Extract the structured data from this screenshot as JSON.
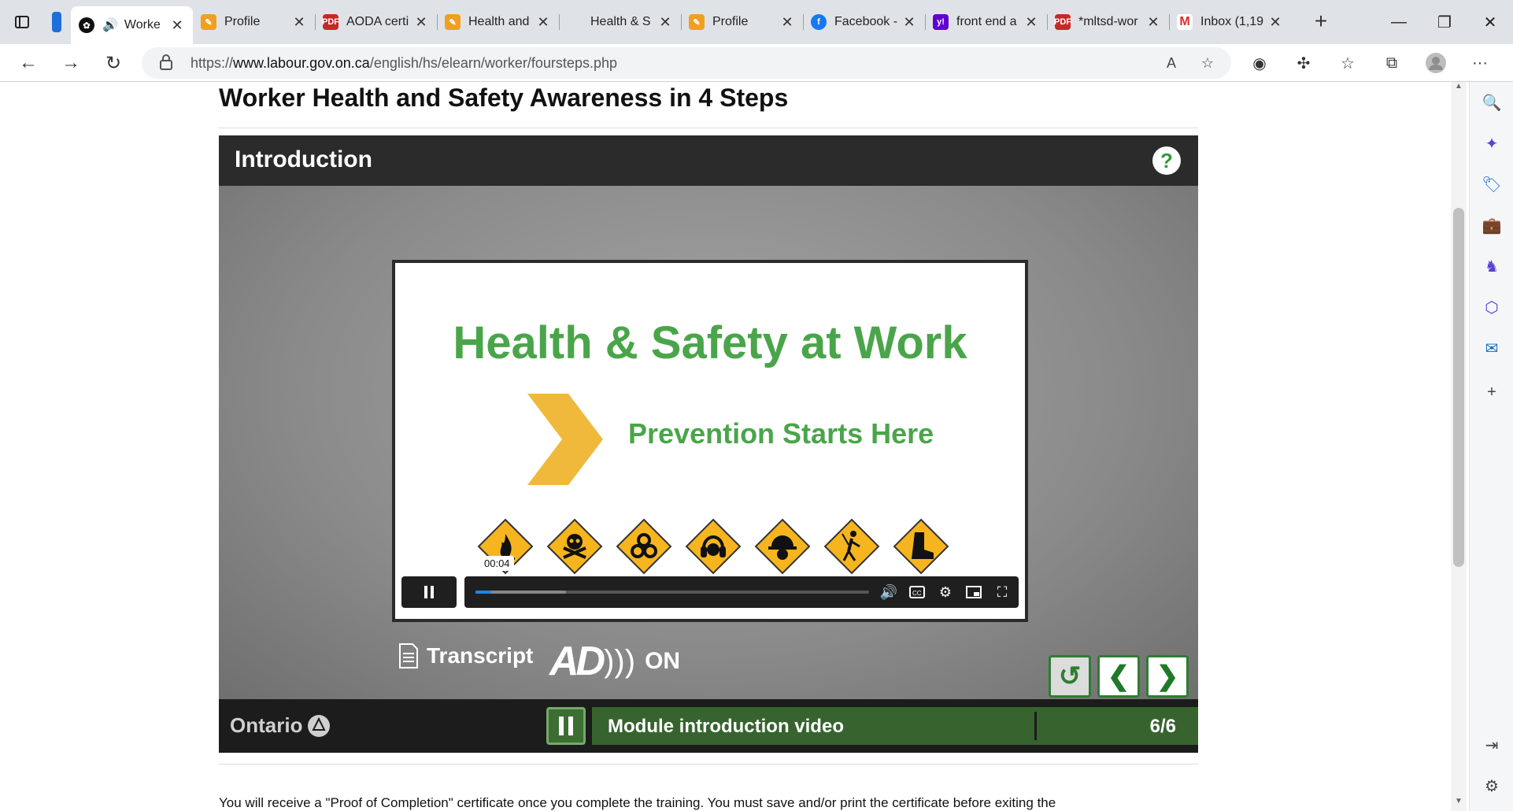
{
  "browser": {
    "tabs": [
      {
        "title": "Worke",
        "active": true,
        "favicon": "ontario-trillium-icon",
        "audio": true
      },
      {
        "title": "Profile",
        "favicon": "pencil-icon"
      },
      {
        "title": "AODA certi",
        "favicon": "pdf-icon"
      },
      {
        "title": "Health and",
        "favicon": "pencil-icon"
      },
      {
        "title": "Health & S",
        "favicon": "none"
      },
      {
        "title": "Profile",
        "favicon": "pencil-icon"
      },
      {
        "title": "Facebook -",
        "favicon": "facebook-icon"
      },
      {
        "title": "front end a",
        "favicon": "yahoo-icon"
      },
      {
        "title": "*mltsd-wor",
        "favicon": "pdf-icon"
      },
      {
        "title": "Inbox (1,19",
        "favicon": "gmail-icon"
      }
    ],
    "url_prefix": "https://",
    "url_host": "www.labour.gov.on.ca",
    "url_path": "/english/hs/elearn/worker/foursteps.php"
  },
  "page": {
    "title": "Worker Health and Safety Awareness in 4 Steps",
    "paragraph": "You will receive a \"Proof of Completion\" certificate once you complete the training. You must save and/or print the certificate before exiting the"
  },
  "player": {
    "header_title": "Introduction",
    "help_label": "?",
    "video_title": "Health & Safety at Work",
    "video_subtitle": "Prevention Starts Here",
    "time_tooltip": "00:04",
    "progress_played": 0.04,
    "progress_buffered": 0.23,
    "transcript_label": "Transcript",
    "ad_label": "AD",
    "ad_state": "ON",
    "brand": "Ontario",
    "module_label": "Module introduction video",
    "module_counter": "6/6",
    "colors": {
      "accent_green": "#4aa54a",
      "dark_green": "#37632f",
      "chevron_yellow": "#f0b93c"
    }
  }
}
